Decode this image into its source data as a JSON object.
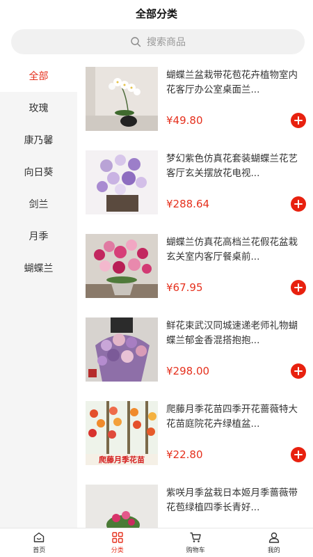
{
  "header": {
    "title": "全部分类"
  },
  "search": {
    "placeholder": "搜索商品"
  },
  "categories": [
    "全部",
    "玫瑰",
    "康乃馨",
    "向日葵",
    "剑兰",
    "月季",
    "蝴蝶兰"
  ],
  "active_category": "全部",
  "products": [
    {
      "title": "蝴蝶兰盆栽带花苞花卉植物室内花客厅办公室桌面兰...",
      "price": "¥49.80",
      "image": "white-orchid-pot"
    },
    {
      "title": "梦幻紫色仿真花套装蝴蝶兰花艺 客厅玄关摆放花电视...",
      "price": "¥288.64",
      "image": "purple-orchid-arrangement"
    },
    {
      "title": "蝴蝶兰仿真花高档兰花假花盆栽玄关室内客厅餐桌前...",
      "price": "¥67.95",
      "image": "pink-orchid-pot"
    },
    {
      "title": "鲜花束武汉同城速递老师礼物蝴蝶兰郁金香混搭抱抱...",
      "price": "¥298.00",
      "image": "purple-bouquet"
    },
    {
      "title": "爬藤月季花苗四季开花蔷薇特大花苗庭院花卉绿植盆...",
      "price": "¥22.80",
      "image": "climbing-rose"
    },
    {
      "title": "紫咲月季盆栽日本姬月季蔷薇带花苞绿植四季长青好...",
      "price": "",
      "image": "rose-pot"
    }
  ],
  "tabs": [
    {
      "label": "首页",
      "icon": "home-icon"
    },
    {
      "label": "分类",
      "icon": "category-icon"
    },
    {
      "label": "购物车",
      "icon": "cart-icon"
    },
    {
      "label": "我的",
      "icon": "user-icon"
    }
  ],
  "colors": {
    "accent": "#e5301d",
    "sidebar_bg": "#f5f5f5",
    "search_bg": "#f1f1f1"
  }
}
